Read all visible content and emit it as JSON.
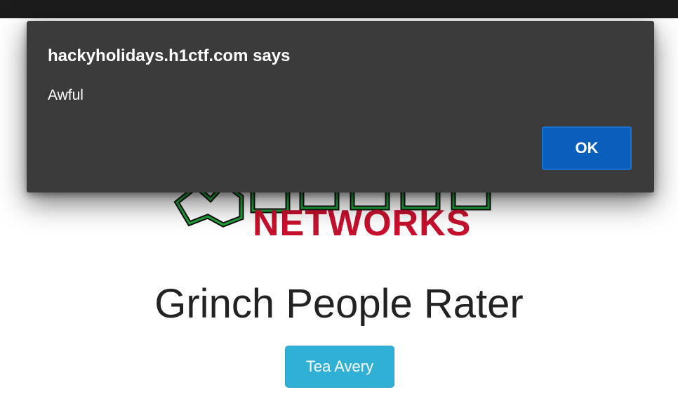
{
  "dialog": {
    "title": "hackyholidays.h1ctf.com says",
    "message": "Awful",
    "ok_label": "OK"
  },
  "page": {
    "logo_text": "NETWORKS",
    "title": "Grinch People Rater",
    "person_button_label": "Tea Avery"
  },
  "colors": {
    "dialog_bg": "#3b3b3b",
    "ok_button": "#0a5fbd",
    "logo_red": "#c8102e",
    "logo_green": "#1fa63a",
    "person_button": "#31b0d5"
  },
  "icons": [
    "grinch-logo"
  ]
}
